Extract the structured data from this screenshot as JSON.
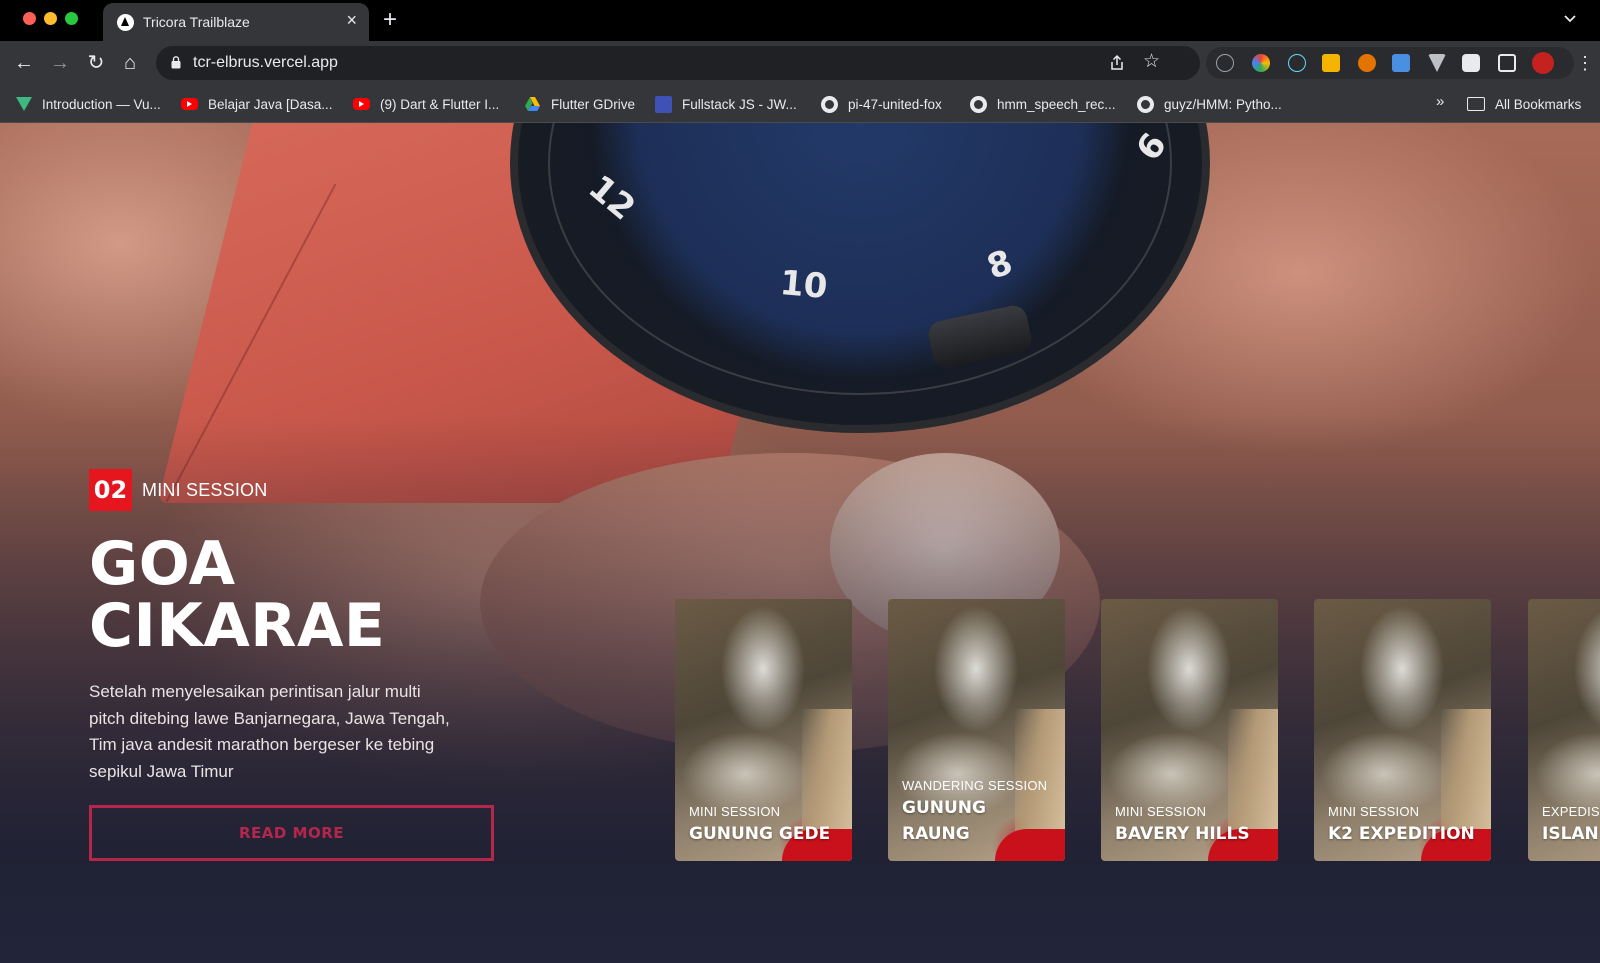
{
  "browser": {
    "tab_title": "Tricora Trailblaze",
    "tab_close": "×",
    "new_tab": "+",
    "url": "tcr-elbrus.vercel.app",
    "nav": {
      "back": "←",
      "forward": "→",
      "reload": "↻",
      "home": "⌂",
      "star": "☆",
      "menu": "⋮"
    },
    "bookmarks": [
      {
        "label": "Introduction — Vu...",
        "icon": "vue-icon"
      },
      {
        "label": "Belajar Java [Dasa...",
        "icon": "youtube-icon"
      },
      {
        "label": "(9) Dart & Flutter I...",
        "icon": "youtube-icon"
      },
      {
        "label": "Flutter GDrive",
        "icon": "google-drive-icon"
      },
      {
        "label": "Fullstack JS - JW...",
        "icon": "jw-icon"
      },
      {
        "label": "pi-47-united-fox",
        "icon": "github-icon"
      },
      {
        "label": "hmm_speech_rec...",
        "icon": "github-icon"
      },
      {
        "label": "guyz/HMM: Pytho...",
        "icon": "github-icon"
      }
    ],
    "bookmarks_more": "»",
    "all_bookmarks": "All Bookmarks"
  },
  "hero": {
    "badge_number": "02",
    "badge_label": "MINI SESSION",
    "title_line1": "GOA",
    "title_line2": "CIKARAE",
    "description": "Setelah menyelesaikan perintisan jalur multi pitch ditebing lawe Banjarnegara, Jawa Tengah, Tim java andesit marathon bergeser ke tebing sepikul Jawa Timur",
    "cta_label": "READ MORE",
    "cta_color": "#b5264b",
    "badge_color": "#e5161e"
  },
  "watch_numbers": [
    "12",
    "10",
    "8",
    "6"
  ],
  "cards": [
    {
      "subtitle": "MINI SESSION",
      "title_line1": "GUNUNG GEDE",
      "title_line2": ""
    },
    {
      "subtitle": "WANDERING SESSION",
      "title_line1": "GUNUNG",
      "title_line2": "RAUNG"
    },
    {
      "subtitle": "MINI SESSION",
      "title_line1": "BAVERY HILLS",
      "title_line2": ""
    },
    {
      "subtitle": "MINI SESSION",
      "title_line1": "K2 EXPEDITION",
      "title_line2": ""
    },
    {
      "subtitle": "EXPEDISI",
      "title_line1": "ISLAN",
      "title_line2": ""
    }
  ]
}
